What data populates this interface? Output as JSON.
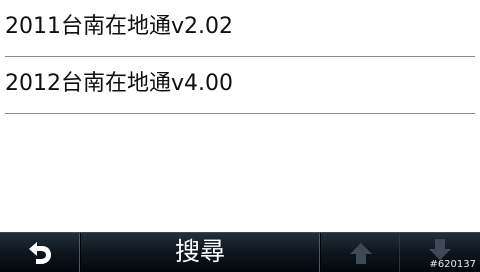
{
  "list": {
    "items": [
      {
        "label": "2011台南在地通v2.02"
      },
      {
        "label": "2012台南在地通v4.00"
      }
    ]
  },
  "toolbar": {
    "back_icon": "back-arrow-icon",
    "search_label": "搜尋",
    "up_icon": "arrow-up-icon",
    "down_icon": "arrow-down-icon",
    "up_enabled": false,
    "down_enabled": false
  },
  "watermark": "#620137",
  "colors": {
    "toolbar_top": "#23303a",
    "toolbar_bottom": "#03070b",
    "divider": "#8c8c8c",
    "disabled_icon": "#3e4a55"
  }
}
